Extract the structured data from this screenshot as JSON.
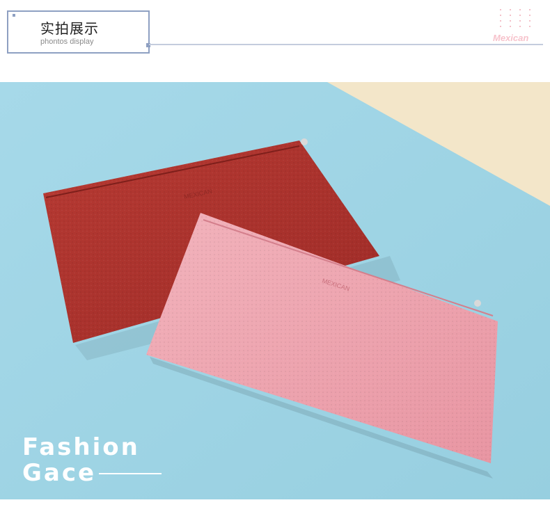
{
  "header": {
    "title_cn": "实拍展示",
    "title_en": "phontos display",
    "brand": "Mexican"
  },
  "photo": {
    "wallet_red_logo": "MEXICAN",
    "wallet_pink_logo": "MEXICAN",
    "caption_line1": "Fashion",
    "caption_line2": "Gace"
  },
  "colors": {
    "accent_frame": "#8ea0c2",
    "brand_pink": "#f7c3cc",
    "background_blue": "#9fd6e6",
    "background_cream": "#f3e6c9",
    "wallet_red": "#b3342f",
    "wallet_pink": "#eea2ad"
  }
}
